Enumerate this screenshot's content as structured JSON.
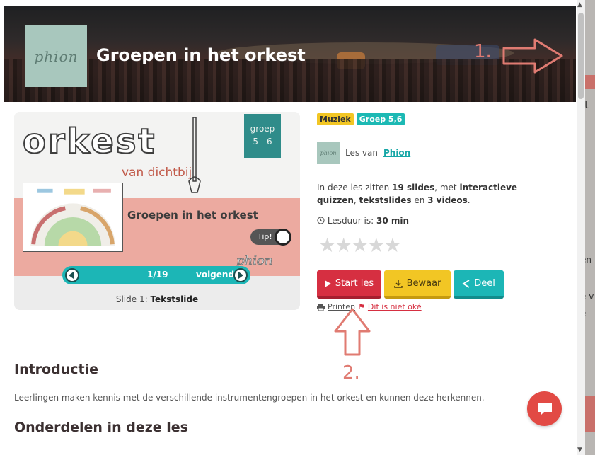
{
  "banner": {
    "logo_text": "phion",
    "title": "Groepen in het orkest"
  },
  "annotations": {
    "label1": "1.",
    "label2": "2."
  },
  "slide_preview": {
    "orkest_word": "orkest",
    "subtitle": "van dichtbij",
    "groep_line1": "groep",
    "groep_line2": "5 - 6",
    "heading": "Groepen in het orkest",
    "tip_label": "Tip!",
    "brand": "phion",
    "counter": "1/19",
    "next_label": "volgende",
    "caption_prefix": "Slide 1:",
    "caption_type": "Tekstslide"
  },
  "tags": [
    "Muziek",
    "Groep 5,6"
  ],
  "author": {
    "avatar_text": "phion",
    "prefix": "Les van",
    "name": "Phion"
  },
  "description": {
    "p1": "In deze les zitten ",
    "slides": "19 slides",
    "p2": ", met ",
    "quizzes": "interactieve quizzen",
    "p3": ", ",
    "textslides": "tekstslides",
    "p4": " en ",
    "videos": "3 videos",
    "p5": "."
  },
  "duration": {
    "label": "Lesduur is:",
    "value": "30 min"
  },
  "rating": {
    "stars": "★★★★★",
    "value": 0,
    "max": 5
  },
  "actions": {
    "start": "Start les",
    "bewaar": "Bewaar",
    "deel": "Deel",
    "print": "Printen",
    "report": "Dit is niet oké"
  },
  "intro": {
    "heading": "Introductie",
    "text": "Leerlingen maken kennis met de verschillende instrumentengroepen in het orkest en kunnen deze herkennen."
  },
  "parts": {
    "heading": "Onderdelen in deze les"
  },
  "background_chars": {
    "c1": "st",
    "c2": "en",
    "c3": "e v",
    "c4": "e"
  },
  "colors": {
    "start": "#d62f41",
    "bewaar": "#f2c624",
    "deel": "#1cb6b6",
    "muziek_tag": "#f2c624",
    "groep_tag": "#1cb9b4",
    "slide_pink": "#ecaaa0",
    "annotation": "#e07b72"
  },
  "icons": [
    "play-icon",
    "download-icon",
    "share-icon",
    "printer-icon",
    "flag-icon",
    "clock-icon",
    "chevron-left-icon",
    "chevron-right-icon",
    "chat-icon"
  ]
}
